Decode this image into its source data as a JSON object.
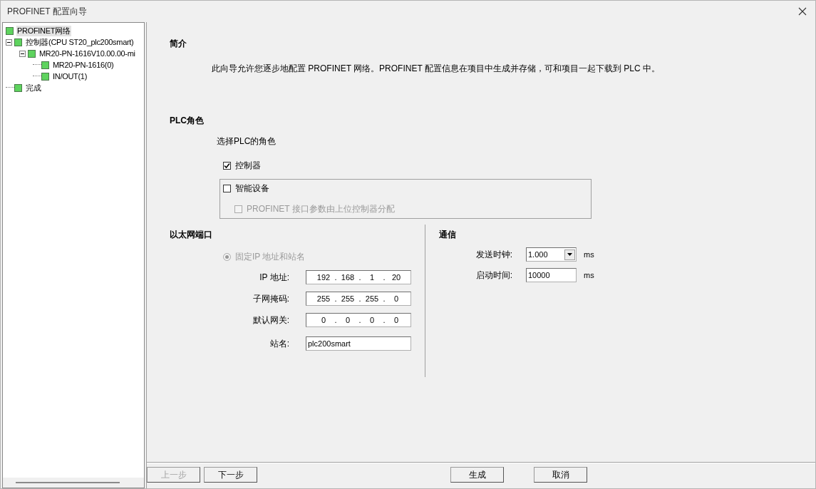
{
  "window": {
    "title": "PROFINET 配置向导"
  },
  "tree": [
    {
      "label": "PROFINET网络",
      "selected": true
    },
    {
      "label": "控制器(CPU ST20_plc200smart)",
      "selected": false,
      "expanded": true,
      "children": [
        {
          "label": "MR20-PN-1616V10.00.00-mi",
          "selected": false,
          "expanded": true,
          "children": [
            {
              "label": "MR20-PN-1616(0)",
              "selected": false
            },
            {
              "label": "IN/OUT(1)",
              "selected": false
            }
          ]
        }
      ]
    },
    {
      "label": "完成",
      "selected": false
    }
  ],
  "intro": {
    "heading": "简介",
    "text": "此向导允许您逐步地配置 PROFINET 网络。PROFINET 配置信息在项目中生成并存储，可和项目一起下载到 PLC 中。"
  },
  "role": {
    "heading": "PLC角色",
    "prompt": "选择PLC的角色",
    "controller": {
      "label": "控制器",
      "checked": true,
      "disabled": false
    },
    "device": {
      "label": "智能设备",
      "checked": false,
      "disabled": false
    },
    "device_option": {
      "label": "PROFINET 接口参数由上位控制器分配",
      "checked": false,
      "disabled": true
    }
  },
  "ethernet": {
    "heading": "以太网端口",
    "radio": {
      "label": "固定IP 地址和站名",
      "selected": true,
      "disabled": true
    },
    "fields": [
      {
        "kind": "ip",
        "label": "IP 地址:",
        "octets": [
          "192",
          "168",
          "1",
          "20"
        ],
        "separators": [
          ".",
          ".",
          "."
        ]
      },
      {
        "kind": "ip",
        "label": "子网掩码:",
        "octets": [
          "255",
          "255",
          "255",
          "0"
        ],
        "separators": [
          ".",
          ".",
          "."
        ]
      },
      {
        "kind": "ip",
        "label": "默认网关:",
        "octets": [
          "0",
          "0",
          "0",
          "0"
        ],
        "separators": [
          ".",
          ".",
          "."
        ]
      },
      {
        "kind": "text",
        "label": "站名:",
        "value": "plc200smart"
      }
    ]
  },
  "communication": {
    "heading": "通信",
    "fields": [
      {
        "kind": "select",
        "label": "发送时钟:",
        "value": "1.000",
        "unit": "ms"
      },
      {
        "kind": "text",
        "label": "启动时间:",
        "value": "10000",
        "unit": "ms"
      }
    ]
  },
  "buttons": [
    {
      "label": "上一步",
      "disabled": true
    },
    {
      "label": "下一步",
      "disabled": false
    },
    {
      "label": "生成",
      "disabled": false
    },
    {
      "label": "取消",
      "disabled": false
    }
  ]
}
